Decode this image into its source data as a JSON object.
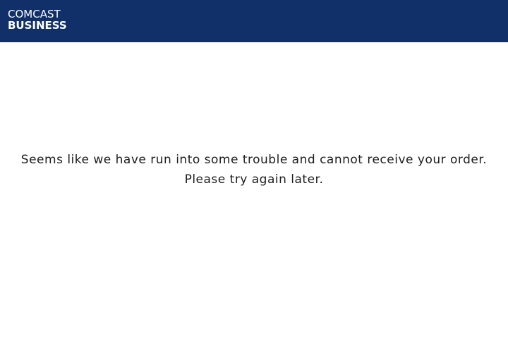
{
  "header": {
    "background_color": "#11306a",
    "logo": {
      "line1": "COMCAST",
      "line2": "BUSINESS",
      "color": "#ffffff"
    }
  },
  "main": {
    "message_line1": "Seems like we have run into some trouble and cannot receive your order.",
    "message_line2": "Please try again later.",
    "text_color": "#1d1d1d"
  }
}
